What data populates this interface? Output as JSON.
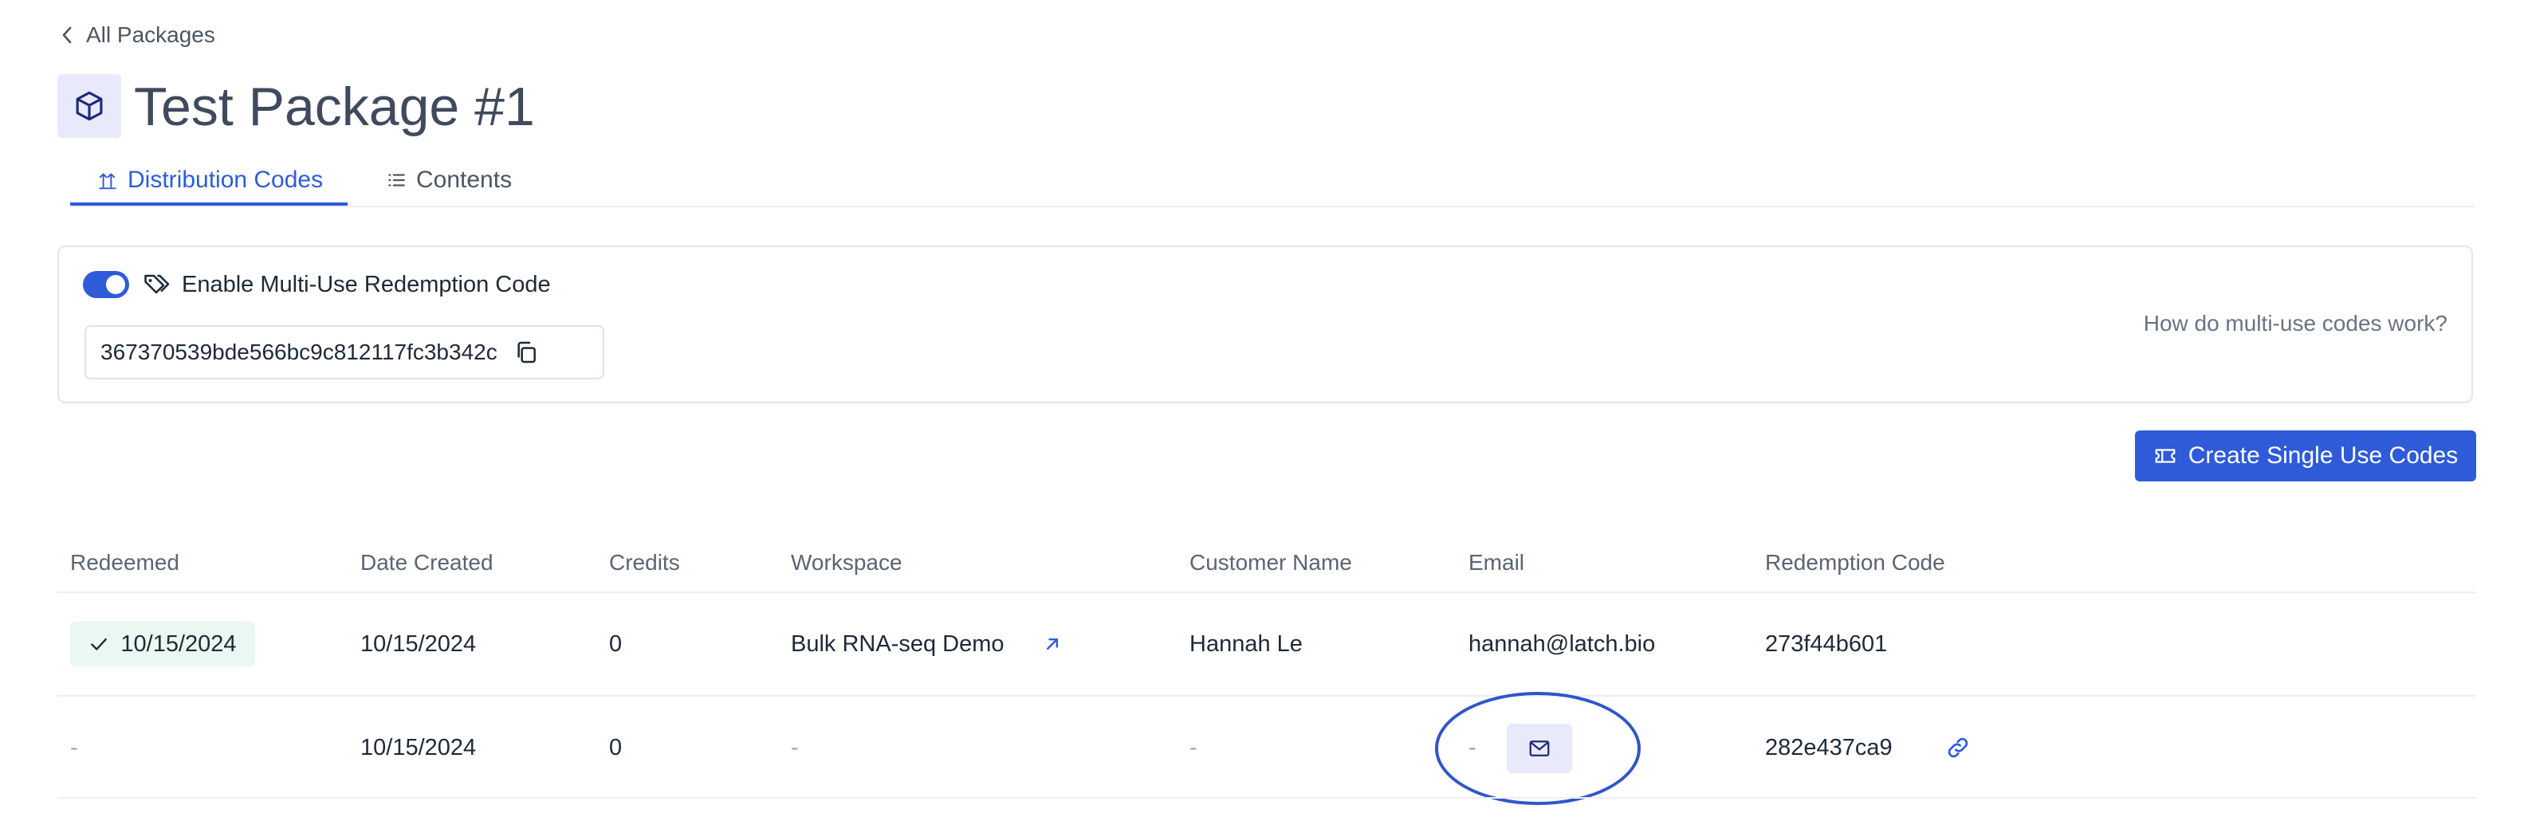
{
  "back": {
    "label": "All Packages",
    "icon": "chevron-left-icon"
  },
  "package": {
    "title": "Test Package #1",
    "icon": "cube-icon"
  },
  "tabs": [
    {
      "label": "Distribution Codes",
      "icon": "upload-arrows-icon",
      "active": true
    },
    {
      "label": "Contents",
      "icon": "list-icon",
      "active": false
    }
  ],
  "multi_use": {
    "toggle_enabled": true,
    "label": "Enable Multi-Use Redemption Code",
    "code": "367370539bde566bc9c812117fc3b342c",
    "help_link": "How do multi-use codes work?"
  },
  "create_button": {
    "label": "Create Single Use Codes",
    "icon": "ticket-icon"
  },
  "table": {
    "columns": [
      "Redeemed",
      "Date Created",
      "Credits",
      "Workspace",
      "Customer Name",
      "Email",
      "Redemption Code"
    ],
    "rows": [
      {
        "redeemed": "10/15/2024",
        "date_created": "10/15/2024",
        "credits": "0",
        "workspace": "Bulk RNA-seq Demo",
        "customer_name": "Hannah Le",
        "email": "hannah@latch.bio",
        "code": "273f44b601"
      },
      {
        "redeemed": "-",
        "date_created": "10/15/2024",
        "credits": "0",
        "workspace": "-",
        "customer_name": "-",
        "email": "-",
        "code": "282e437ca9"
      }
    ]
  },
  "colors": {
    "accent": "#2f5bd9",
    "redeemed_badge_bg": "#e9f8f0",
    "annotation_circle": "#2f56c9"
  }
}
